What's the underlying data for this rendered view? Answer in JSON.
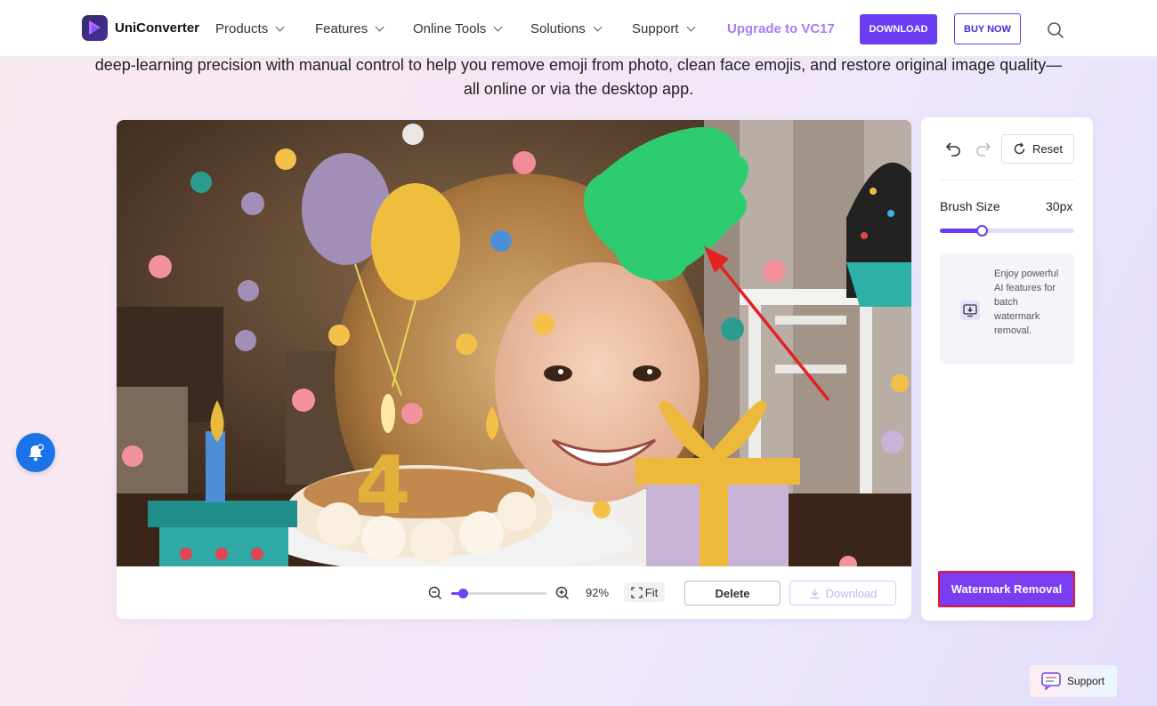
{
  "header": {
    "brand": "UniConverter",
    "nav": [
      "Products",
      "Features",
      "Online Tools",
      "Solutions",
      "Support"
    ],
    "upgrade_label": "Upgrade to VC17",
    "download_label": "DOWNLOAD",
    "buy_label": "BUY NOW"
  },
  "intro_text": "deep-learning precision with manual control to help you remove emoji from photo, clean face emojis, and restore original image quality—all online or via the desktop app.",
  "editor": {
    "zoom_percent": 92,
    "zoom_label": "92%",
    "fit_label": "Fit",
    "delete_label": "Delete",
    "download_label": "Download"
  },
  "panel": {
    "reset_label": "Reset",
    "brush_label": "Brush Size",
    "brush_value": "30px",
    "brush_fraction": 0.31,
    "promo_text": "Enjoy powerful AI features for batch watermark removal.",
    "watermark_label": "Watermark Removal"
  },
  "support_label": "Support",
  "colors": {
    "accent": "#6a3df2",
    "upgrade": "#a67cf5",
    "highlight_border": "#e0182d",
    "brush_stroke": "#2ecc71",
    "arrow": "#e32222"
  },
  "icons": [
    "search-icon",
    "undo-icon",
    "redo-icon",
    "reset-icon",
    "zoom-out-icon",
    "zoom-in-icon",
    "fit-icon",
    "download-icon",
    "desktop-download-icon",
    "bell-icon",
    "chat-icon"
  ]
}
